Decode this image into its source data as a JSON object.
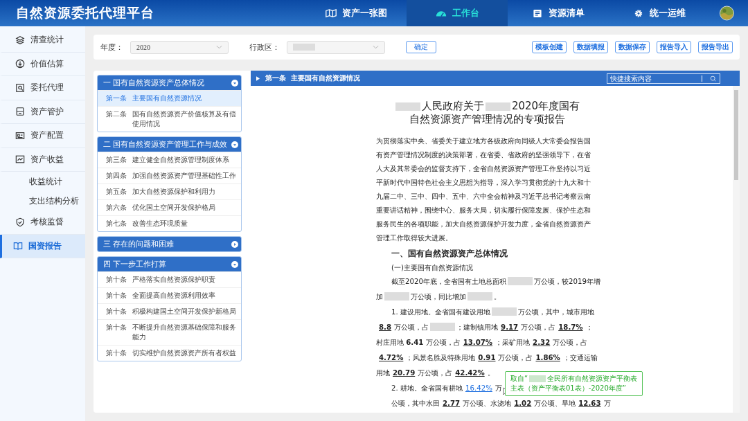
{
  "app": {
    "title": "自然资源委托代理平台"
  },
  "nav": [
    {
      "label": "资产一张图",
      "selected": false
    },
    {
      "label": "工作台",
      "selected": true
    },
    {
      "label": "资源清单",
      "selected": false
    },
    {
      "label": "统一运维",
      "selected": false
    }
  ],
  "sidebar": [
    {
      "label": "清查统计",
      "kind": "item",
      "selected": false
    },
    {
      "label": "价值估算",
      "kind": "item",
      "selected": false
    },
    {
      "label": "委托代理",
      "kind": "item",
      "selected": false
    },
    {
      "label": "资产管护",
      "kind": "item",
      "selected": false
    },
    {
      "label": "资产配置",
      "kind": "item",
      "selected": false
    },
    {
      "label": "资产收益",
      "kind": "item",
      "selected": false
    },
    {
      "label": "收益统计",
      "kind": "sub",
      "selected": false
    },
    {
      "label": "支出结构分析",
      "kind": "sub",
      "selected": false
    },
    {
      "label": "考核监督",
      "kind": "item",
      "selected": false
    },
    {
      "label": "国资报告",
      "kind": "item",
      "selected": true
    }
  ],
  "filters": [
    {
      "label": "年度：",
      "value": "2020"
    },
    {
      "label": "行政区："
    }
  ],
  "confirm_button": "确定",
  "actions": [
    "模板创建",
    "数据填报",
    "数据保存",
    "报告导入",
    "报告导出"
  ],
  "outline": [
    {
      "title": "一 国有自然资源资产总体情况",
      "expanded": true,
      "items": [
        {
          "no": "第一条",
          "text": "主要国有自然资源情况",
          "selected": true
        },
        {
          "no": "第二条",
          "text": "国有自然资源资产价值核算及有偿使用情况",
          "selected": false
        }
      ]
    },
    {
      "title": "二 国有自然资源资产管理工作与成效",
      "expanded": true,
      "items": [
        {
          "no": "第三条",
          "text": "建立健全自然资源管理制度体系",
          "selected": false
        },
        {
          "no": "第四条",
          "text": "加强自然资源资产管理基础性工作",
          "selected": false
        },
        {
          "no": "第五条",
          "text": "加大自然资源保护和利用力",
          "selected": false
        },
        {
          "no": "第六条",
          "text": "优化国土空间开发保护格局",
          "selected": false
        },
        {
          "no": "第七条",
          "text": "改善生态环境质量",
          "selected": false
        }
      ]
    },
    {
      "title": "三 存在的问题和困难",
      "expanded": false
    },
    {
      "title": "四 下一步工作打算",
      "expanded": true,
      "items": [
        {
          "no": "第十条",
          "text": "严格落实自然资源保护职责",
          "selected": false
        },
        {
          "no": "第十条",
          "text": "全面提高自然资源利用效率",
          "selected": false
        },
        {
          "no": "第十条",
          "text": "积极构建国土空间开发保护新格局",
          "selected": false
        },
        {
          "no": "第十条",
          "text": "不断提升自然资源基础保障和服务能力",
          "selected": false
        },
        {
          "no": "第十条",
          "text": "切实维护自然资源资产所有者权益",
          "selected": false
        }
      ]
    }
  ],
  "document": {
    "breadcrumb": "第一条  主要国有自然资源情况",
    "search": {
      "placeholder": "快捷搜索内容"
    },
    "blocks": [
      {
        "kind": "title",
        "lines": [
          [
            {
              "kind": "blank"
            },
            "人民政府关于",
            {
              "kind": "blank"
            },
            "2020年度国有"
          ],
          [
            "自然资源资产管理情况的专项报告"
          ]
        ]
      },
      {
        "kind": "para",
        "indent": false,
        "lines": [
          [
            "为贯彻落实中央、省委关于建立地方各级政府向同级人大常委会报告国"
          ],
          [
            "有资产管理情况制度的决策部署，在省委、省政府的坚强领导下，在省"
          ],
          [
            "人大及其常委会的监督支持下，全省自然资源资产管理工作坚持以习近"
          ],
          [
            "平新时代中国特色社会主义思想为指导，深入学习贯彻党的十九大和十"
          ],
          [
            "九届二中、三中、四中、五中、六中全会精神及习近平总书记考察云南"
          ],
          [
            "重要讲话精神，围绕中心、服务大局，切实履行保障发展、保护生态和"
          ],
          [
            "服务民生的各项职能，加大自然资源保护开发力度，全省自然资源资产"
          ],
          [
            "管理工作取得较大进展。"
          ]
        ]
      },
      {
        "kind": "heading",
        "lines": [
          [
            "一、国有自然资源资产总体情况"
          ]
        ]
      },
      {
        "kind": "subheading",
        "lines": [
          [
            "(一)主要国有自然资源情况"
          ]
        ]
      },
      {
        "kind": "para",
        "indent": true,
        "lines": [
          [
            "截至2020年底，全省国有土地总面积",
            {
              "kind": "blank"
            },
            "万公顷，较2019年增"
          ],
          [
            "加",
            {
              "kind": "blank"
            },
            "万公顷，同比增加",
            {
              "kind": "blank"
            },
            "。"
          ]
        ]
      },
      {
        "kind": "para",
        "indent": true,
        "lines": [
          [
            "1. 建设用地。全省国有建设用地",
            {
              "kind": "blank"
            },
            "万公顷，其中，城市用地"
          ],
          [
            {
              "kind": "value",
              "text": "8.8"
            },
            "万公顷，占",
            {
              "kind": "blank"
            },
            "；建制镇用地",
            {
              "kind": "value",
              "text": "9.17"
            },
            "万公顷，占",
            {
              "kind": "value",
              "text": "18.7%"
            },
            "；"
          ],
          [
            "村庄用地 ",
            {
              "kind": "number",
              "text": "6.41"
            },
            " 万公顷，占",
            {
              "kind": "value",
              "text": "13.07%"
            },
            "；采矿用地",
            {
              "kind": "value",
              "text": "2.32"
            },
            "万公顷，占"
          ],
          [
            {
              "kind": "value",
              "text": "4.72%"
            },
            "；风景名胜及特殊用地",
            {
              "kind": "value",
              "text": "0.91"
            },
            "万公顷，占",
            {
              "kind": "value",
              "text": "1.86%"
            },
            "；交通运输"
          ],
          [
            "用地",
            {
              "kind": "value",
              "text": "20.79"
            },
            "万公顷，占",
            {
              "kind": "value",
              "text": "42.42%"
            },
            "。"
          ]
        ]
      },
      {
        "kind": "para",
        "indent": true,
        "lines": [
          [
            "2. 耕地。全省国有耕地",
            {
              "kind": "link",
              "text": "16.42%"
            },
            "万"
          ],
          [
            "公顷，其中水田",
            {
              "kind": "value",
              "text": "2.77"
            },
            "万公顷、水浇地",
            {
              "kind": "value",
              "text": "1.02"
            },
            "万公顷、旱地",
            {
              "kind": "value",
              "text": "12.63"
            },
            "万"
          ]
        ],
        "tooltip": {
          "lines": [
            [
              "取自“",
              {
                "kind": "blank"
              },
              "全民所有自然资源资产平衡表"
            ],
            [
              "主表（资产平衡表01表）-2020年度”"
            ]
          ]
        }
      }
    ]
  }
}
